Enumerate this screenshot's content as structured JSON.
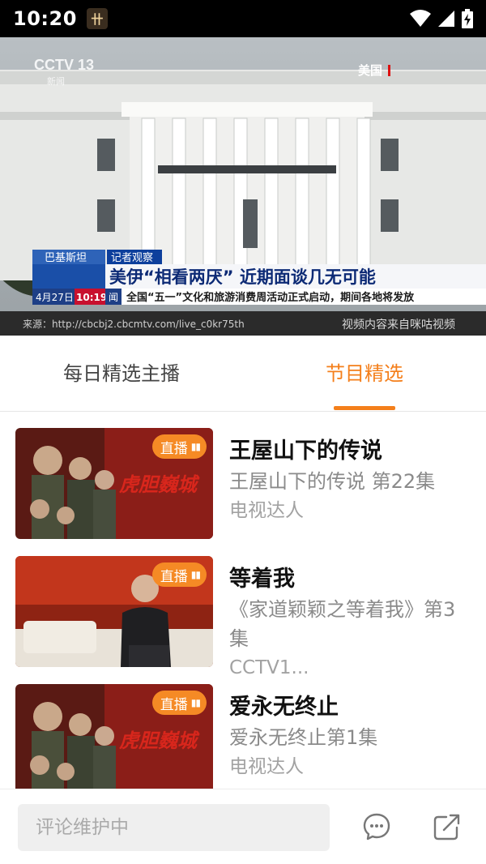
{
  "status_bar": {
    "time": "10:20",
    "app_icon_glyph": "卄"
  },
  "video": {
    "channel_logo": "CCTV 13",
    "channel_sub": "新闻",
    "location_tag": "美国",
    "banner_tag1": "巴基斯坦",
    "banner_tag2": "记者观察",
    "headline": "美伊“相看两厌” 近期面谈几无可能",
    "date": "4月27日",
    "clock": "10:19",
    "ticker_label": "闻",
    "ticker": "全国“五一”文化和旅游消费周活动正式启动，期间各地将发放",
    "source": "来源：http://cbcbj2.cbcmtv.com/live_c0kr75th",
    "provider": "视频内容来自咪咕视频"
  },
  "tabs": [
    {
      "label": "每日精选主播"
    },
    {
      "label": "节目精选"
    }
  ],
  "programs": [
    {
      "title": "王屋山下的传说",
      "subtitle": "王屋山下的传说 第22集",
      "meta": "电视达人",
      "badge": "直播",
      "poster_text": "虎胆巍城"
    },
    {
      "title": "等着我",
      "subtitle": "《家道颖颖之等着我》第3集",
      "meta": "CCTV1...",
      "badge": "直播",
      "poster_text": ""
    },
    {
      "title": "爱永无终止",
      "subtitle": "爱永无终止第1集",
      "meta": "电视达人",
      "badge": "直播",
      "poster_text": "虎胆巍城"
    }
  ],
  "comment": {
    "placeholder": "评论维护中"
  },
  "icons": {
    "chat": "chat-bubble-icon",
    "share": "share-icon"
  },
  "colors": {
    "accent": "#f47f1b",
    "badge": "#f58a25"
  }
}
